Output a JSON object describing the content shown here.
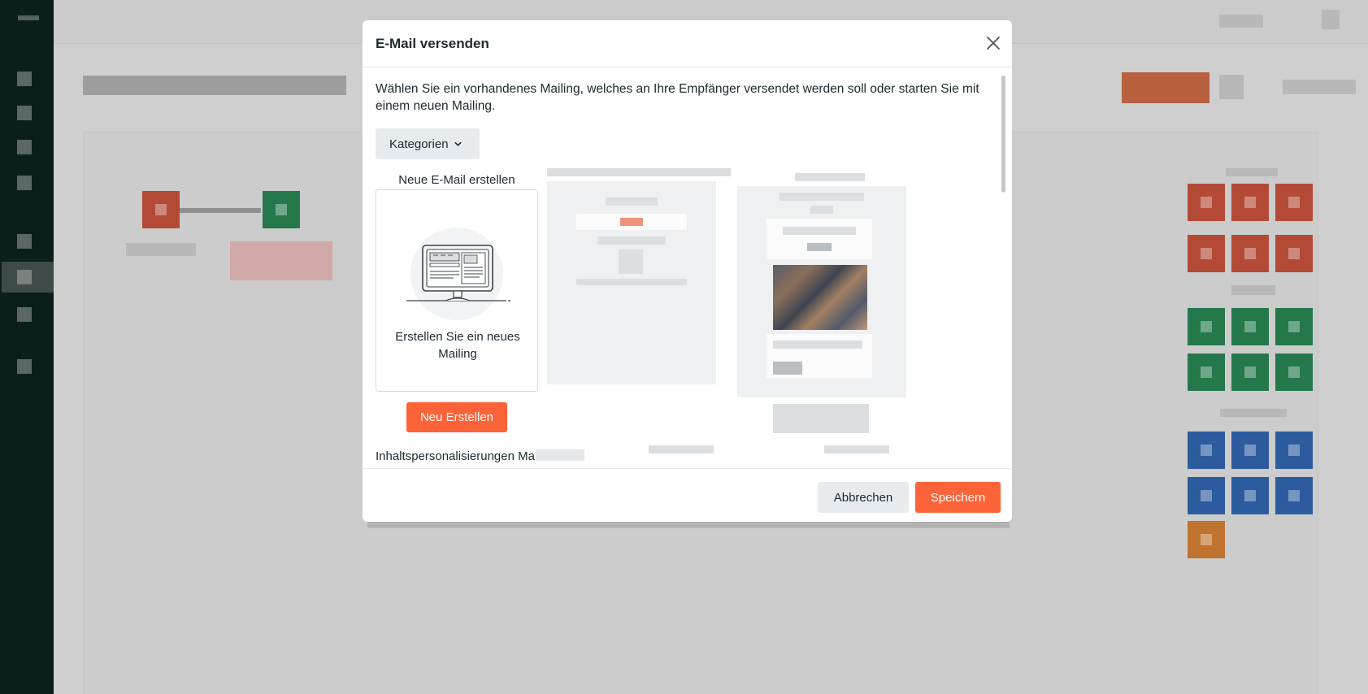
{
  "modal": {
    "title": "E-Mail versenden",
    "intro": "Wählen Sie ein vorhandenes Mailing, welches an Ihre Empfänger versendet werden soll oder starten Sie mit einem neuen Mailing.",
    "categories_label": "Kategorien",
    "new_template": {
      "label": "Neue E-Mail erstellen",
      "card_text": "Erstellen Sie ein neues Mailing",
      "button_label": "Neu Erstellen"
    },
    "section_label_partial": "Inhaltspersonalisierungen Ma",
    "footer": {
      "cancel_label": "Abbrechen",
      "save_label": "Speichern"
    }
  },
  "colors": {
    "primary": "#fd6339",
    "secondary_button": "#e8ebed",
    "sidebar": "#0c1e1c",
    "text": "#1d2a30"
  },
  "icons": {
    "close": "close-icon",
    "chevron": "chevron-down-icon",
    "illustration": "monitor-illustration-icon"
  }
}
